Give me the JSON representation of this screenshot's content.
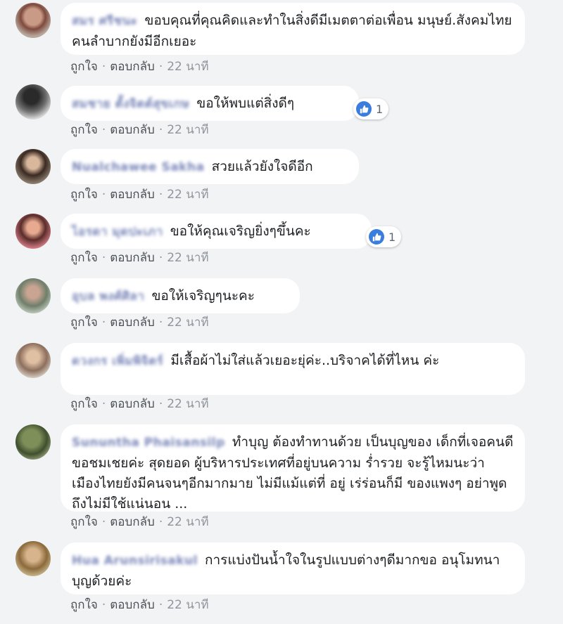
{
  "action_labels": {
    "like": "ถูกใจ",
    "reply": "ตอบกลับ",
    "separator": "·"
  },
  "comments": [
    {
      "author": "สมร ศรีชนะ",
      "text": "ขอบคุณที่คุณคิดและทำในสิ่งดีมีเมตตาต่อเพื่อน มนุษย์.สังคมไทยคนลำบากยังมีอีกเยอะ",
      "time": "22 นาที"
    },
    {
      "author": "สมชาย ตั้งจิตต์สุขเกษ",
      "text": "ขอให้พบแต่สิ่งดีๆ",
      "time": "22 นาที",
      "reaction_count": "1"
    },
    {
      "author": "Nualchawee Sakha",
      "text": "สวยแล้วยังใจดีอีก",
      "time": "22 นาที"
    },
    {
      "author": "ไอรดา มุดปะเภา",
      "text": "ขอให้คุณเจริญยิ่งๆขึ้นคะ",
      "time": "22 นาที",
      "reaction_count": "1"
    },
    {
      "author": "อุบล พงศ์ศิลา",
      "text": "ขอให้เจริญๆนะคะ",
      "time": "22 นาที"
    },
    {
      "author": "ดวงกร เพิ่มพิจิตร์",
      "text": "มีเสื้อผ้าไม่ใส่แล้วเยอะยุ่ค่ะ..บริจาคได้ที่ไหน ค่ะ",
      "time": "22 นาที"
    },
    {
      "author": "Sununtha Phaisansilp",
      "text": "ทำบุญ ต้องทำทานด้วย เป็นบุญของ เด็กที่เจอคนดี ขอชมเชยค่ะ สุดยอด ผู้บริหารประเทศที่อยู่บนความ ร่ำรวย จะรู้ไหมนะว่า เมืองไทยยังมีคนจนๆอีกมากมาย ไม่มีแม้แต่ที่ อยู่ เร่ร่อนก็มี ของแพงๆ อย่าพูดถึงไม่มีใช้แน่นอน ...",
      "time": "22 นาที"
    },
    {
      "author": "Hua Arunsirisakul",
      "text": "การแบ่งปันน้ำใจในรูปแบบต่างๆดีมากขอ อนุโมทนาบุญด้วยค่ะ",
      "time": "22 นาที"
    }
  ],
  "colors": {
    "background": "#f2f3f5",
    "bubble": "#ffffff",
    "like_blue": "#3b7ddd",
    "meta_gray": "#90949c"
  }
}
